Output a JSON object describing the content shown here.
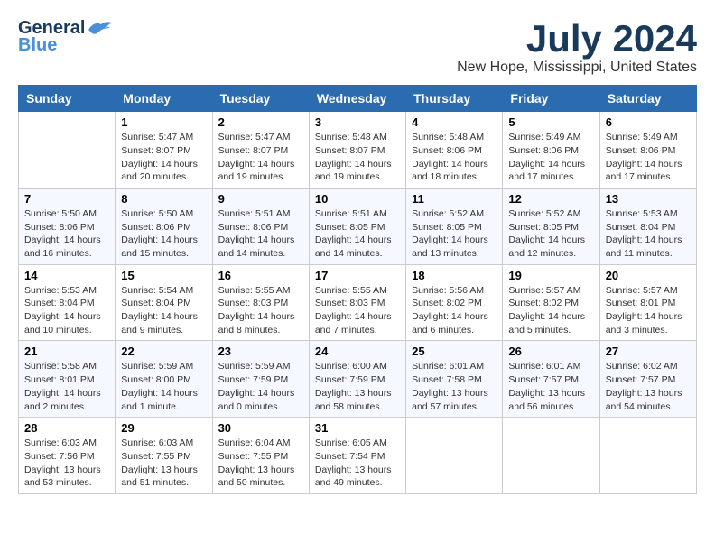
{
  "header": {
    "logo_line1": "General",
    "logo_line2": "Blue",
    "month_title": "July 2024",
    "location": "New Hope, Mississippi, United States"
  },
  "calendar": {
    "days_of_week": [
      "Sunday",
      "Monday",
      "Tuesday",
      "Wednesday",
      "Thursday",
      "Friday",
      "Saturday"
    ],
    "weeks": [
      [
        {
          "day": "",
          "info": ""
        },
        {
          "day": "1",
          "info": "Sunrise: 5:47 AM\nSunset: 8:07 PM\nDaylight: 14 hours\nand 20 minutes."
        },
        {
          "day": "2",
          "info": "Sunrise: 5:47 AM\nSunset: 8:07 PM\nDaylight: 14 hours\nand 19 minutes."
        },
        {
          "day": "3",
          "info": "Sunrise: 5:48 AM\nSunset: 8:07 PM\nDaylight: 14 hours\nand 19 minutes."
        },
        {
          "day": "4",
          "info": "Sunrise: 5:48 AM\nSunset: 8:06 PM\nDaylight: 14 hours\nand 18 minutes."
        },
        {
          "day": "5",
          "info": "Sunrise: 5:49 AM\nSunset: 8:06 PM\nDaylight: 14 hours\nand 17 minutes."
        },
        {
          "day": "6",
          "info": "Sunrise: 5:49 AM\nSunset: 8:06 PM\nDaylight: 14 hours\nand 17 minutes."
        }
      ],
      [
        {
          "day": "7",
          "info": "Sunrise: 5:50 AM\nSunset: 8:06 PM\nDaylight: 14 hours\nand 16 minutes."
        },
        {
          "day": "8",
          "info": "Sunrise: 5:50 AM\nSunset: 8:06 PM\nDaylight: 14 hours\nand 15 minutes."
        },
        {
          "day": "9",
          "info": "Sunrise: 5:51 AM\nSunset: 8:06 PM\nDaylight: 14 hours\nand 14 minutes."
        },
        {
          "day": "10",
          "info": "Sunrise: 5:51 AM\nSunset: 8:05 PM\nDaylight: 14 hours\nand 14 minutes."
        },
        {
          "day": "11",
          "info": "Sunrise: 5:52 AM\nSunset: 8:05 PM\nDaylight: 14 hours\nand 13 minutes."
        },
        {
          "day": "12",
          "info": "Sunrise: 5:52 AM\nSunset: 8:05 PM\nDaylight: 14 hours\nand 12 minutes."
        },
        {
          "day": "13",
          "info": "Sunrise: 5:53 AM\nSunset: 8:04 PM\nDaylight: 14 hours\nand 11 minutes."
        }
      ],
      [
        {
          "day": "14",
          "info": "Sunrise: 5:53 AM\nSunset: 8:04 PM\nDaylight: 14 hours\nand 10 minutes."
        },
        {
          "day": "15",
          "info": "Sunrise: 5:54 AM\nSunset: 8:04 PM\nDaylight: 14 hours\nand 9 minutes."
        },
        {
          "day": "16",
          "info": "Sunrise: 5:55 AM\nSunset: 8:03 PM\nDaylight: 14 hours\nand 8 minutes."
        },
        {
          "day": "17",
          "info": "Sunrise: 5:55 AM\nSunset: 8:03 PM\nDaylight: 14 hours\nand 7 minutes."
        },
        {
          "day": "18",
          "info": "Sunrise: 5:56 AM\nSunset: 8:02 PM\nDaylight: 14 hours\nand 6 minutes."
        },
        {
          "day": "19",
          "info": "Sunrise: 5:57 AM\nSunset: 8:02 PM\nDaylight: 14 hours\nand 5 minutes."
        },
        {
          "day": "20",
          "info": "Sunrise: 5:57 AM\nSunset: 8:01 PM\nDaylight: 14 hours\nand 3 minutes."
        }
      ],
      [
        {
          "day": "21",
          "info": "Sunrise: 5:58 AM\nSunset: 8:01 PM\nDaylight: 14 hours\nand 2 minutes."
        },
        {
          "day": "22",
          "info": "Sunrise: 5:59 AM\nSunset: 8:00 PM\nDaylight: 14 hours\nand 1 minute."
        },
        {
          "day": "23",
          "info": "Sunrise: 5:59 AM\nSunset: 7:59 PM\nDaylight: 14 hours\nand 0 minutes."
        },
        {
          "day": "24",
          "info": "Sunrise: 6:00 AM\nSunset: 7:59 PM\nDaylight: 13 hours\nand 58 minutes."
        },
        {
          "day": "25",
          "info": "Sunrise: 6:01 AM\nSunset: 7:58 PM\nDaylight: 13 hours\nand 57 minutes."
        },
        {
          "day": "26",
          "info": "Sunrise: 6:01 AM\nSunset: 7:57 PM\nDaylight: 13 hours\nand 56 minutes."
        },
        {
          "day": "27",
          "info": "Sunrise: 6:02 AM\nSunset: 7:57 PM\nDaylight: 13 hours\nand 54 minutes."
        }
      ],
      [
        {
          "day": "28",
          "info": "Sunrise: 6:03 AM\nSunset: 7:56 PM\nDaylight: 13 hours\nand 53 minutes."
        },
        {
          "day": "29",
          "info": "Sunrise: 6:03 AM\nSunset: 7:55 PM\nDaylight: 13 hours\nand 51 minutes."
        },
        {
          "day": "30",
          "info": "Sunrise: 6:04 AM\nSunset: 7:55 PM\nDaylight: 13 hours\nand 50 minutes."
        },
        {
          "day": "31",
          "info": "Sunrise: 6:05 AM\nSunset: 7:54 PM\nDaylight: 13 hours\nand 49 minutes."
        },
        {
          "day": "",
          "info": ""
        },
        {
          "day": "",
          "info": ""
        },
        {
          "day": "",
          "info": ""
        }
      ]
    ]
  }
}
